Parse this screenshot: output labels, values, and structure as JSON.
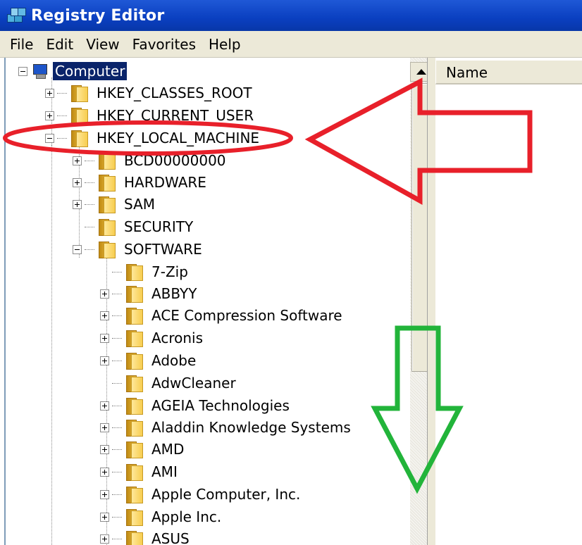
{
  "window": {
    "title": "Registry Editor"
  },
  "menu": [
    "File",
    "Edit",
    "View",
    "Favorites",
    "Help"
  ],
  "right_pane": {
    "column_name": "Name"
  },
  "tree": {
    "root": "Computer",
    "hives": [
      "HKEY_CLASSES_ROOT",
      "HKEY_CURRENT_USER",
      "HKEY_LOCAL_MACHINE"
    ],
    "hklm_children": [
      "BCD00000000",
      "HARDWARE",
      "SAM",
      "SECURITY",
      "SOFTWARE"
    ],
    "software_children": [
      "7-Zip",
      "ABBYY",
      "ACE Compression Software",
      "Acronis",
      "Adobe",
      "AdwCleaner",
      "AGEIA Technologies",
      "Aladdin Knowledge Systems",
      "AMD",
      "AMI",
      "Apple Computer, Inc.",
      "Apple Inc.",
      "ASUS"
    ]
  },
  "annotations": {
    "highlight_color": "#e8202a",
    "arrow_left_color": "#e8202a",
    "arrow_down_color": "#22b43a"
  }
}
